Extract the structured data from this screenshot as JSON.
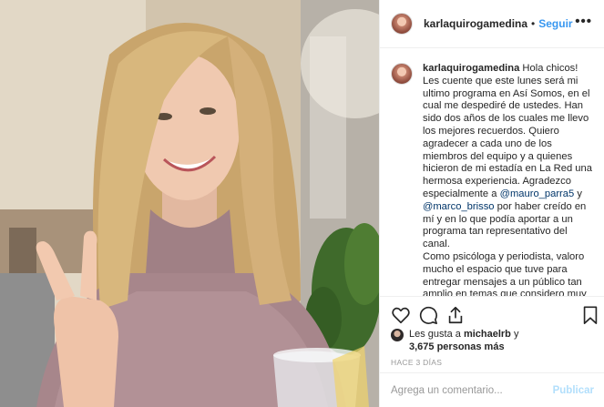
{
  "post": {
    "username": "karlaquirogamedina",
    "separator": "•",
    "follow_label": "Seguir",
    "more_icon": "more-options-icon",
    "caption_username": "karlaquirogamedina",
    "caption_part1": " Hola chicos! Les cuente que este lunes será mi ultimo programa en Así Somos, en el cual me despediré de ustedes. Han sido dos años de los cuales me llevo los mejores recuerdos. Quiero agradecer a cada uno de los miembros del equipo y a quienes hicieron de mi estadía en La Red una hermosa experiencia. Agradezco especialmente a ",
    "mention1": "@mauro_parra5",
    "caption_part2": " y ",
    "mention2": "@marco_brisso",
    "caption_part3": " por haber creído en mí y en lo que podía aportar a un programa tan representativo del canal.",
    "caption_part4": "Como psicóloga y periodista, valoro mucho el espacio que tuve para entregar mensajes a un público tan amplio en temas que considero muy importantes..."
  },
  "actions": {
    "like_icon": "heart-icon",
    "comment_icon": "comment-icon",
    "share_icon": "share-icon",
    "save_icon": "bookmark-icon"
  },
  "likes": {
    "line1_prefix": "Les gusta a ",
    "liker": "michaelrb",
    "line1_suffix": " y",
    "count": "3,675 personas más"
  },
  "timestamp": "HACE 3 DÍAS",
  "comment_box": {
    "placeholder": "Agrega un comentario...",
    "publish_label": "Publicar"
  },
  "colors": {
    "link_blue": "#3897f0",
    "mention_blue": "#003569",
    "muted_gray": "#999999",
    "border": "#efefef"
  }
}
